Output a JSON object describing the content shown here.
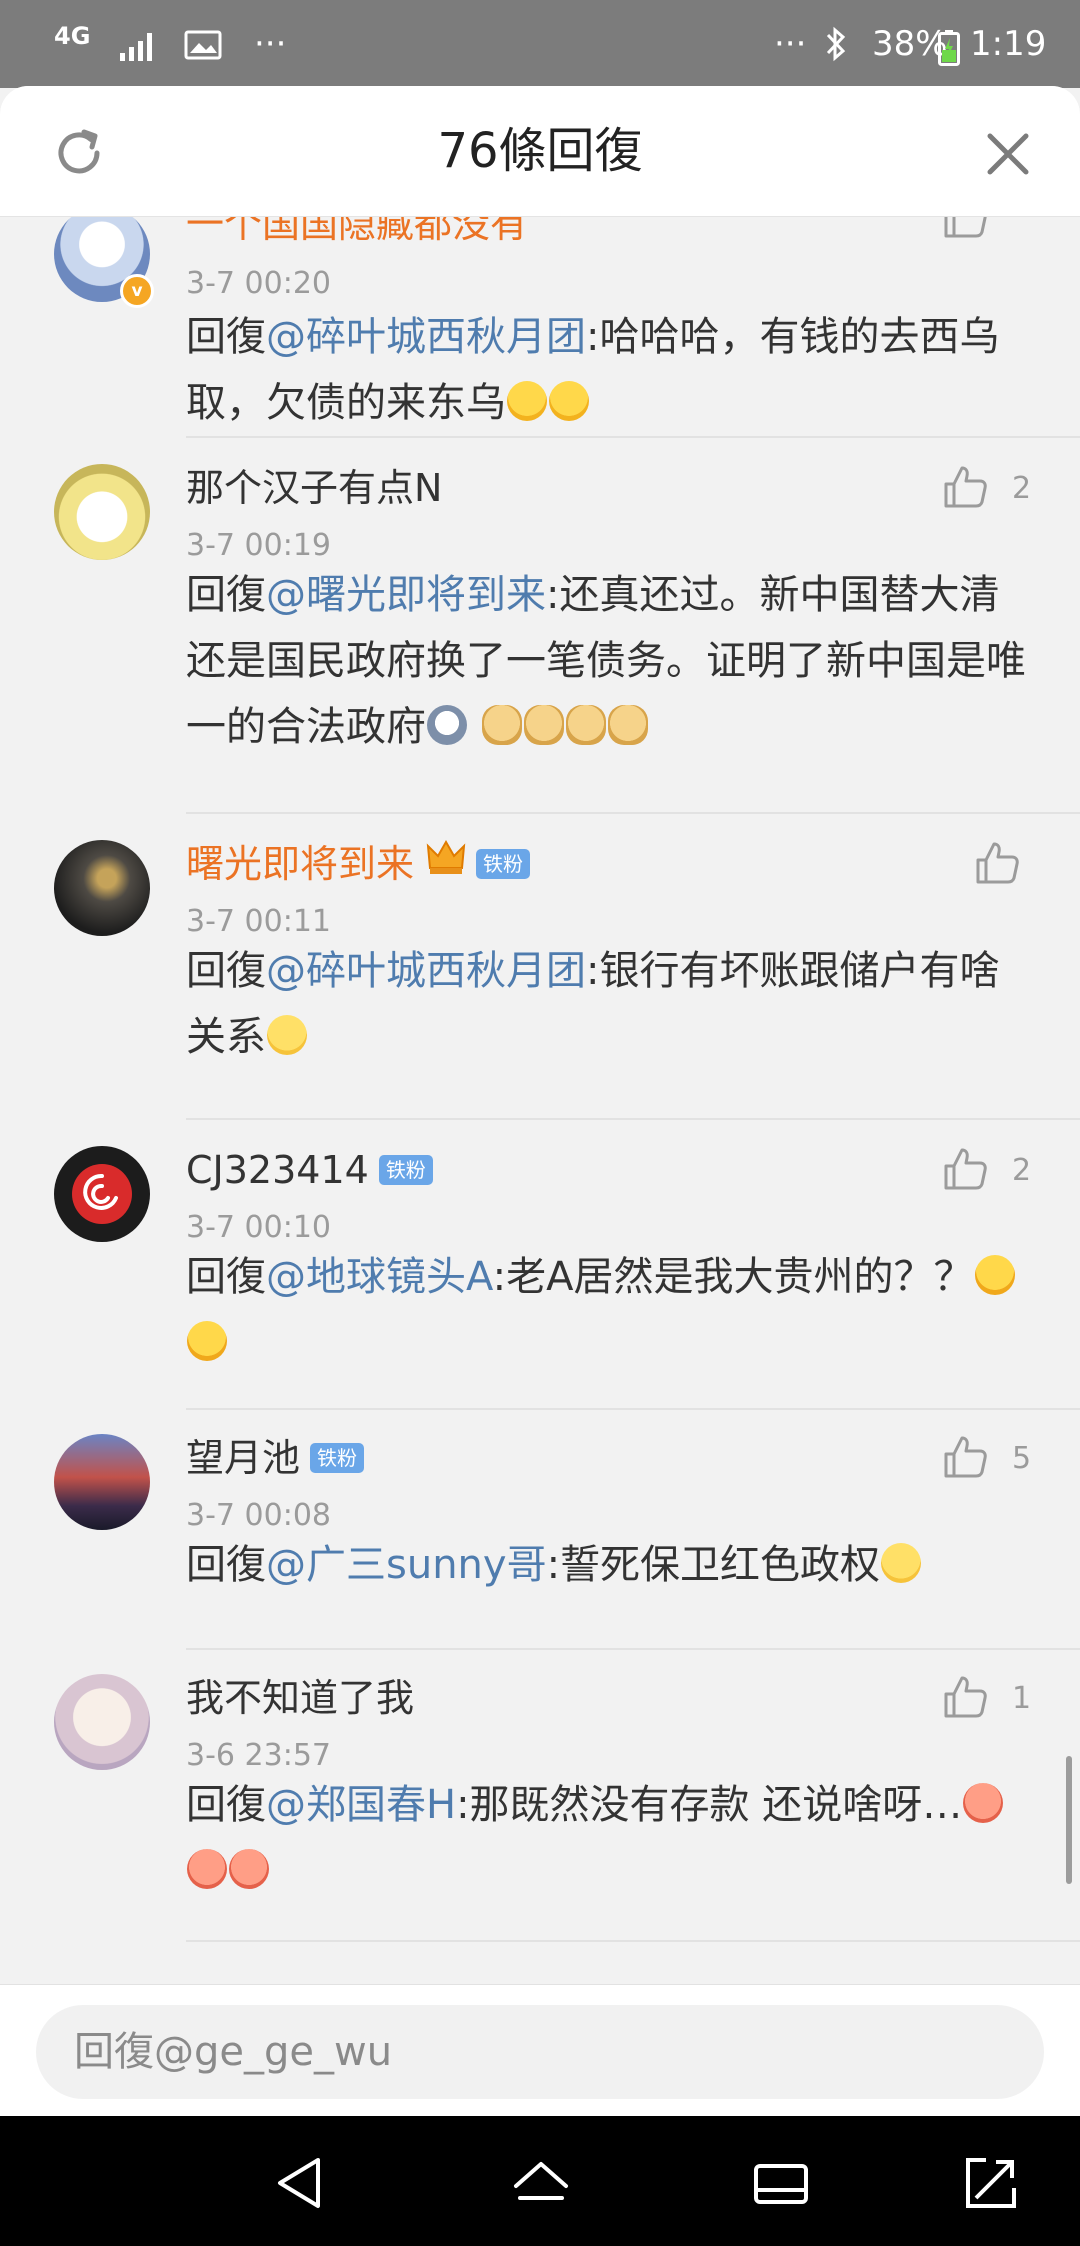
{
  "status_bar": {
    "network": "4G",
    "battery_percent": "38%",
    "time": "1:19",
    "dots": "···"
  },
  "header": {
    "title": "76條回復"
  },
  "comments": [
    {
      "username": "一个国国隐藏都没有",
      "timestamp": "3-7 00:20",
      "prefix": "回復",
      "mention": "@碎叶城西秋月团",
      "text": ":哈哈哈，有钱的去西乌取，欠债的来东乌",
      "emojis": [
        "lol",
        "lol"
      ],
      "likes": ""
    },
    {
      "username": "那个汉子有点N",
      "timestamp": "3-7 00:19",
      "prefix": "回復",
      "mention": "@曙光即将到来",
      "text": ":还真还过。新中国替大清还是国民政府换了一笔债务。证明了新中国是唯一的合法政府",
      "emojis": [
        "husky",
        "doge",
        "doge",
        "doge",
        "doge"
      ],
      "likes": "2"
    },
    {
      "username": "曙光即将到来",
      "badge": "铁粉",
      "timestamp": "3-7 00:11",
      "prefix": "回復",
      "mention": "@碎叶城西秋月团",
      "text": ":银行有坏账跟储户有啥关系",
      "emojis": [
        "smile"
      ],
      "likes": ""
    },
    {
      "username": "CJ323414",
      "badge": "铁粉",
      "timestamp": "3-7 00:10",
      "prefix": "回復",
      "mention": "@地球镜头A",
      "text": ":老A居然是我大贵州的？？",
      "emojis": [
        "shock",
        "shock"
      ],
      "likes": "2"
    },
    {
      "username": "望月池",
      "badge": "铁粉",
      "timestamp": "3-7 00:08",
      "prefix": "回復",
      "mention": "@广三sunny哥",
      "text": ":誓死保卫红色政权",
      "emojis": [
        "smile"
      ],
      "likes": "5"
    },
    {
      "username": "我不知道了我",
      "timestamp": "3-6 23:57",
      "prefix": "回復",
      "mention": "@郑国春H",
      "text": ":那既然没有存款 还说啥呀…",
      "emojis": [
        "pig",
        "pig",
        "pig"
      ],
      "likes": "1"
    }
  ],
  "input": {
    "placeholder": "回復@ge_ge_wu"
  },
  "colors": {
    "mention": "#4f7cae",
    "orange_username": "#eb7324",
    "fan_badge": "#6aa6e8"
  }
}
